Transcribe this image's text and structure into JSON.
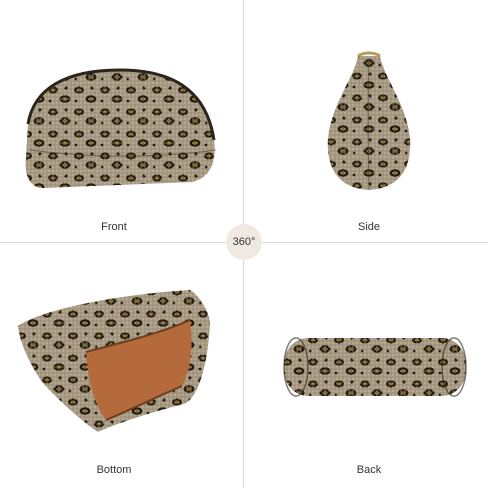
{
  "views": {
    "front": "Front",
    "side": "Side",
    "bottom": "Bottom",
    "back": "Back"
  },
  "badge": "360°",
  "colors": {
    "sequin_base": "#a89a82",
    "spot_dark": "#1c1812",
    "spot_gold": "#8a6a2a",
    "lining": "#b46a3a",
    "divider": "#d9d9d9",
    "badge_bg": "#efe9e1"
  }
}
